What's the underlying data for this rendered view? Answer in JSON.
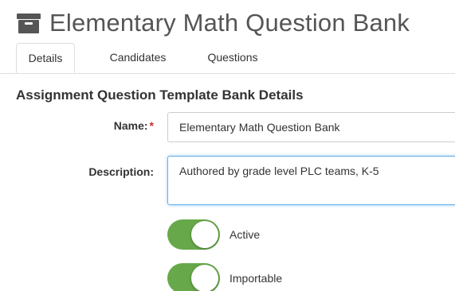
{
  "header": {
    "icon": "archive-icon",
    "title": "Elementary Math Question Bank"
  },
  "tabs": [
    {
      "label": "Details",
      "active": true
    },
    {
      "label": "Candidates",
      "active": false
    },
    {
      "label": "Questions",
      "active": false
    }
  ],
  "section": {
    "title": "Assignment Question Template Bank Details"
  },
  "form": {
    "name_label": "Name:",
    "required_marker": "*",
    "name_value": "Elementary Math Question Bank",
    "description_label": "Description:",
    "description_value": "Authored by grade level PLC teams, K-5"
  },
  "toggles": [
    {
      "label": "Active",
      "on": true
    },
    {
      "label": "Importable",
      "on": true
    }
  ],
  "colors": {
    "toggle_on": "#67a84a",
    "focus_border": "#66afe9",
    "required": "#c9302c"
  }
}
